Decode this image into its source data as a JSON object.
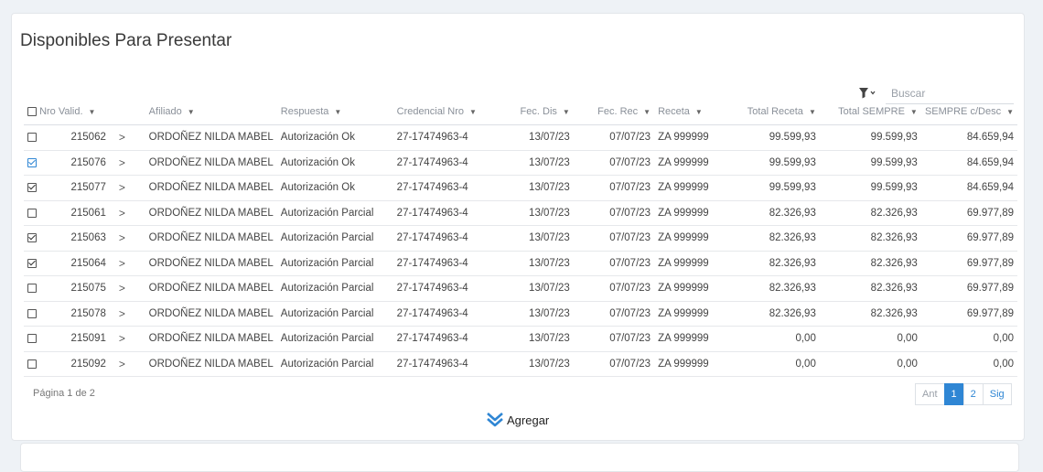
{
  "title": "Disponibles Para Presentar",
  "search": {
    "placeholder": "Buscar"
  },
  "columns": {
    "nro": "Nro Valid.",
    "afiliado": "Afiliado",
    "respuesta": "Respuesta",
    "credencial": "Credencial Nro",
    "fecdis": "Fec. Dis",
    "fecrec": "Fec. Rec",
    "receta": "Receta",
    "total": "Total Receta",
    "sempre": "Total SEMPRE",
    "desc": "SEMPRE c/Desc"
  },
  "rows": [
    {
      "nro": "215062",
      "afiliado": "ORDOÑEZ NILDA MABEL",
      "respuesta": "Autorización Ok",
      "credencial": "27-17474963-4",
      "fecdis": "13/07/23",
      "fecrec": "07/07/23",
      "receta": "ZA 999999",
      "total": "99.599,93",
      "sempre": "99.599,93",
      "desc": "84.659,94",
      "checked": false
    },
    {
      "nro": "215076",
      "afiliado": "ORDOÑEZ NILDA MABEL",
      "respuesta": "Autorización Ok",
      "credencial": "27-17474963-4",
      "fecdis": "13/07/23",
      "fecrec": "07/07/23",
      "receta": "ZA 999999",
      "total": "99.599,93",
      "sempre": "99.599,93",
      "desc": "84.659,94",
      "checked": true
    },
    {
      "nro": "215077",
      "afiliado": "ORDOÑEZ NILDA MABEL",
      "respuesta": "Autorización Ok",
      "credencial": "27-17474963-4",
      "fecdis": "13/07/23",
      "fecrec": "07/07/23",
      "receta": "ZA 999999",
      "total": "99.599,93",
      "sempre": "99.599,93",
      "desc": "84.659,94",
      "checked": true
    },
    {
      "nro": "215061",
      "afiliado": "ORDOÑEZ NILDA MABEL",
      "respuesta": "Autorización Parcial",
      "credencial": "27-17474963-4",
      "fecdis": "13/07/23",
      "fecrec": "07/07/23",
      "receta": "ZA 999999",
      "total": "82.326,93",
      "sempre": "82.326,93",
      "desc": "69.977,89",
      "checked": false
    },
    {
      "nro": "215063",
      "afiliado": "ORDOÑEZ NILDA MABEL",
      "respuesta": "Autorización Parcial",
      "credencial": "27-17474963-4",
      "fecdis": "13/07/23",
      "fecrec": "07/07/23",
      "receta": "ZA 999999",
      "total": "82.326,93",
      "sempre": "82.326,93",
      "desc": "69.977,89",
      "checked": true
    },
    {
      "nro": "215064",
      "afiliado": "ORDOÑEZ NILDA MABEL",
      "respuesta": "Autorización Parcial",
      "credencial": "27-17474963-4",
      "fecdis": "13/07/23",
      "fecrec": "07/07/23",
      "receta": "ZA 999999",
      "total": "82.326,93",
      "sempre": "82.326,93",
      "desc": "69.977,89",
      "checked": true
    },
    {
      "nro": "215075",
      "afiliado": "ORDOÑEZ NILDA MABEL",
      "respuesta": "Autorización Parcial",
      "credencial": "27-17474963-4",
      "fecdis": "13/07/23",
      "fecrec": "07/07/23",
      "receta": "ZA 999999",
      "total": "82.326,93",
      "sempre": "82.326,93",
      "desc": "69.977,89",
      "checked": false
    },
    {
      "nro": "215078",
      "afiliado": "ORDOÑEZ NILDA MABEL",
      "respuesta": "Autorización Parcial",
      "credencial": "27-17474963-4",
      "fecdis": "13/07/23",
      "fecrec": "07/07/23",
      "receta": "ZA 999999",
      "total": "82.326,93",
      "sempre": "82.326,93",
      "desc": "69.977,89",
      "checked": false
    },
    {
      "nro": "215091",
      "afiliado": "ORDOÑEZ NILDA MABEL",
      "respuesta": "Autorización Parcial",
      "credencial": "27-17474963-4",
      "fecdis": "13/07/23",
      "fecrec": "07/07/23",
      "receta": "ZA 999999",
      "total": "0,00",
      "sempre": "0,00",
      "desc": "0,00",
      "checked": false
    },
    {
      "nro": "215092",
      "afiliado": "ORDOÑEZ NILDA MABEL",
      "respuesta": "Autorización Parcial",
      "credencial": "27-17474963-4",
      "fecdis": "13/07/23",
      "fecrec": "07/07/23",
      "receta": "ZA 999999",
      "total": "0,00",
      "sempre": "0,00",
      "desc": "0,00",
      "checked": false
    }
  ],
  "pagination": {
    "info": "Página 1 de 2",
    "prev": "Ant",
    "pages": [
      "1",
      "2"
    ],
    "current": "1",
    "next": "Sig"
  },
  "add_label": "Agregar",
  "colors": {
    "accent": "#2f86d4"
  },
  "icons": {
    "filter": "filter-icon",
    "expand": "chevron-right-icon",
    "add": "double-chevron-down-icon"
  }
}
